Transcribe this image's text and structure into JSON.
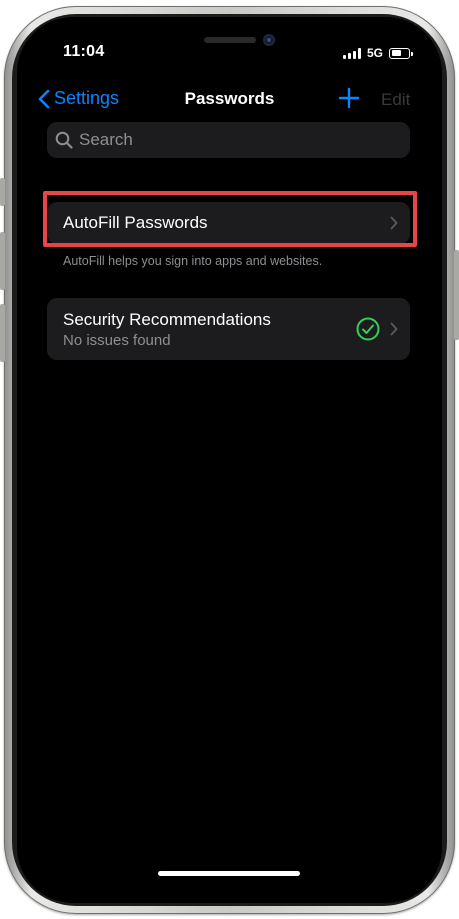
{
  "status": {
    "time": "11:04",
    "network": "5G",
    "battery_level": 0.6
  },
  "nav": {
    "back_label": "Settings",
    "title": "Passwords",
    "edit_label": "Edit"
  },
  "search": {
    "placeholder": "Search"
  },
  "autofill": {
    "label": "AutoFill Passwords",
    "footer": "AutoFill helps you sign into apps and websites."
  },
  "security": {
    "label": "Security Recommendations",
    "status": "No issues found"
  },
  "colors": {
    "accent": "#0a84ff",
    "highlight": "#e64647",
    "ok": "#30d158",
    "background": "#000000",
    "cell": "#1c1c1e"
  },
  "icons": [
    "chevron-left-icon",
    "plus-icon",
    "search-icon",
    "chevron-right-icon",
    "checkmark-circle-icon",
    "signal-icon",
    "battery-icon"
  ]
}
